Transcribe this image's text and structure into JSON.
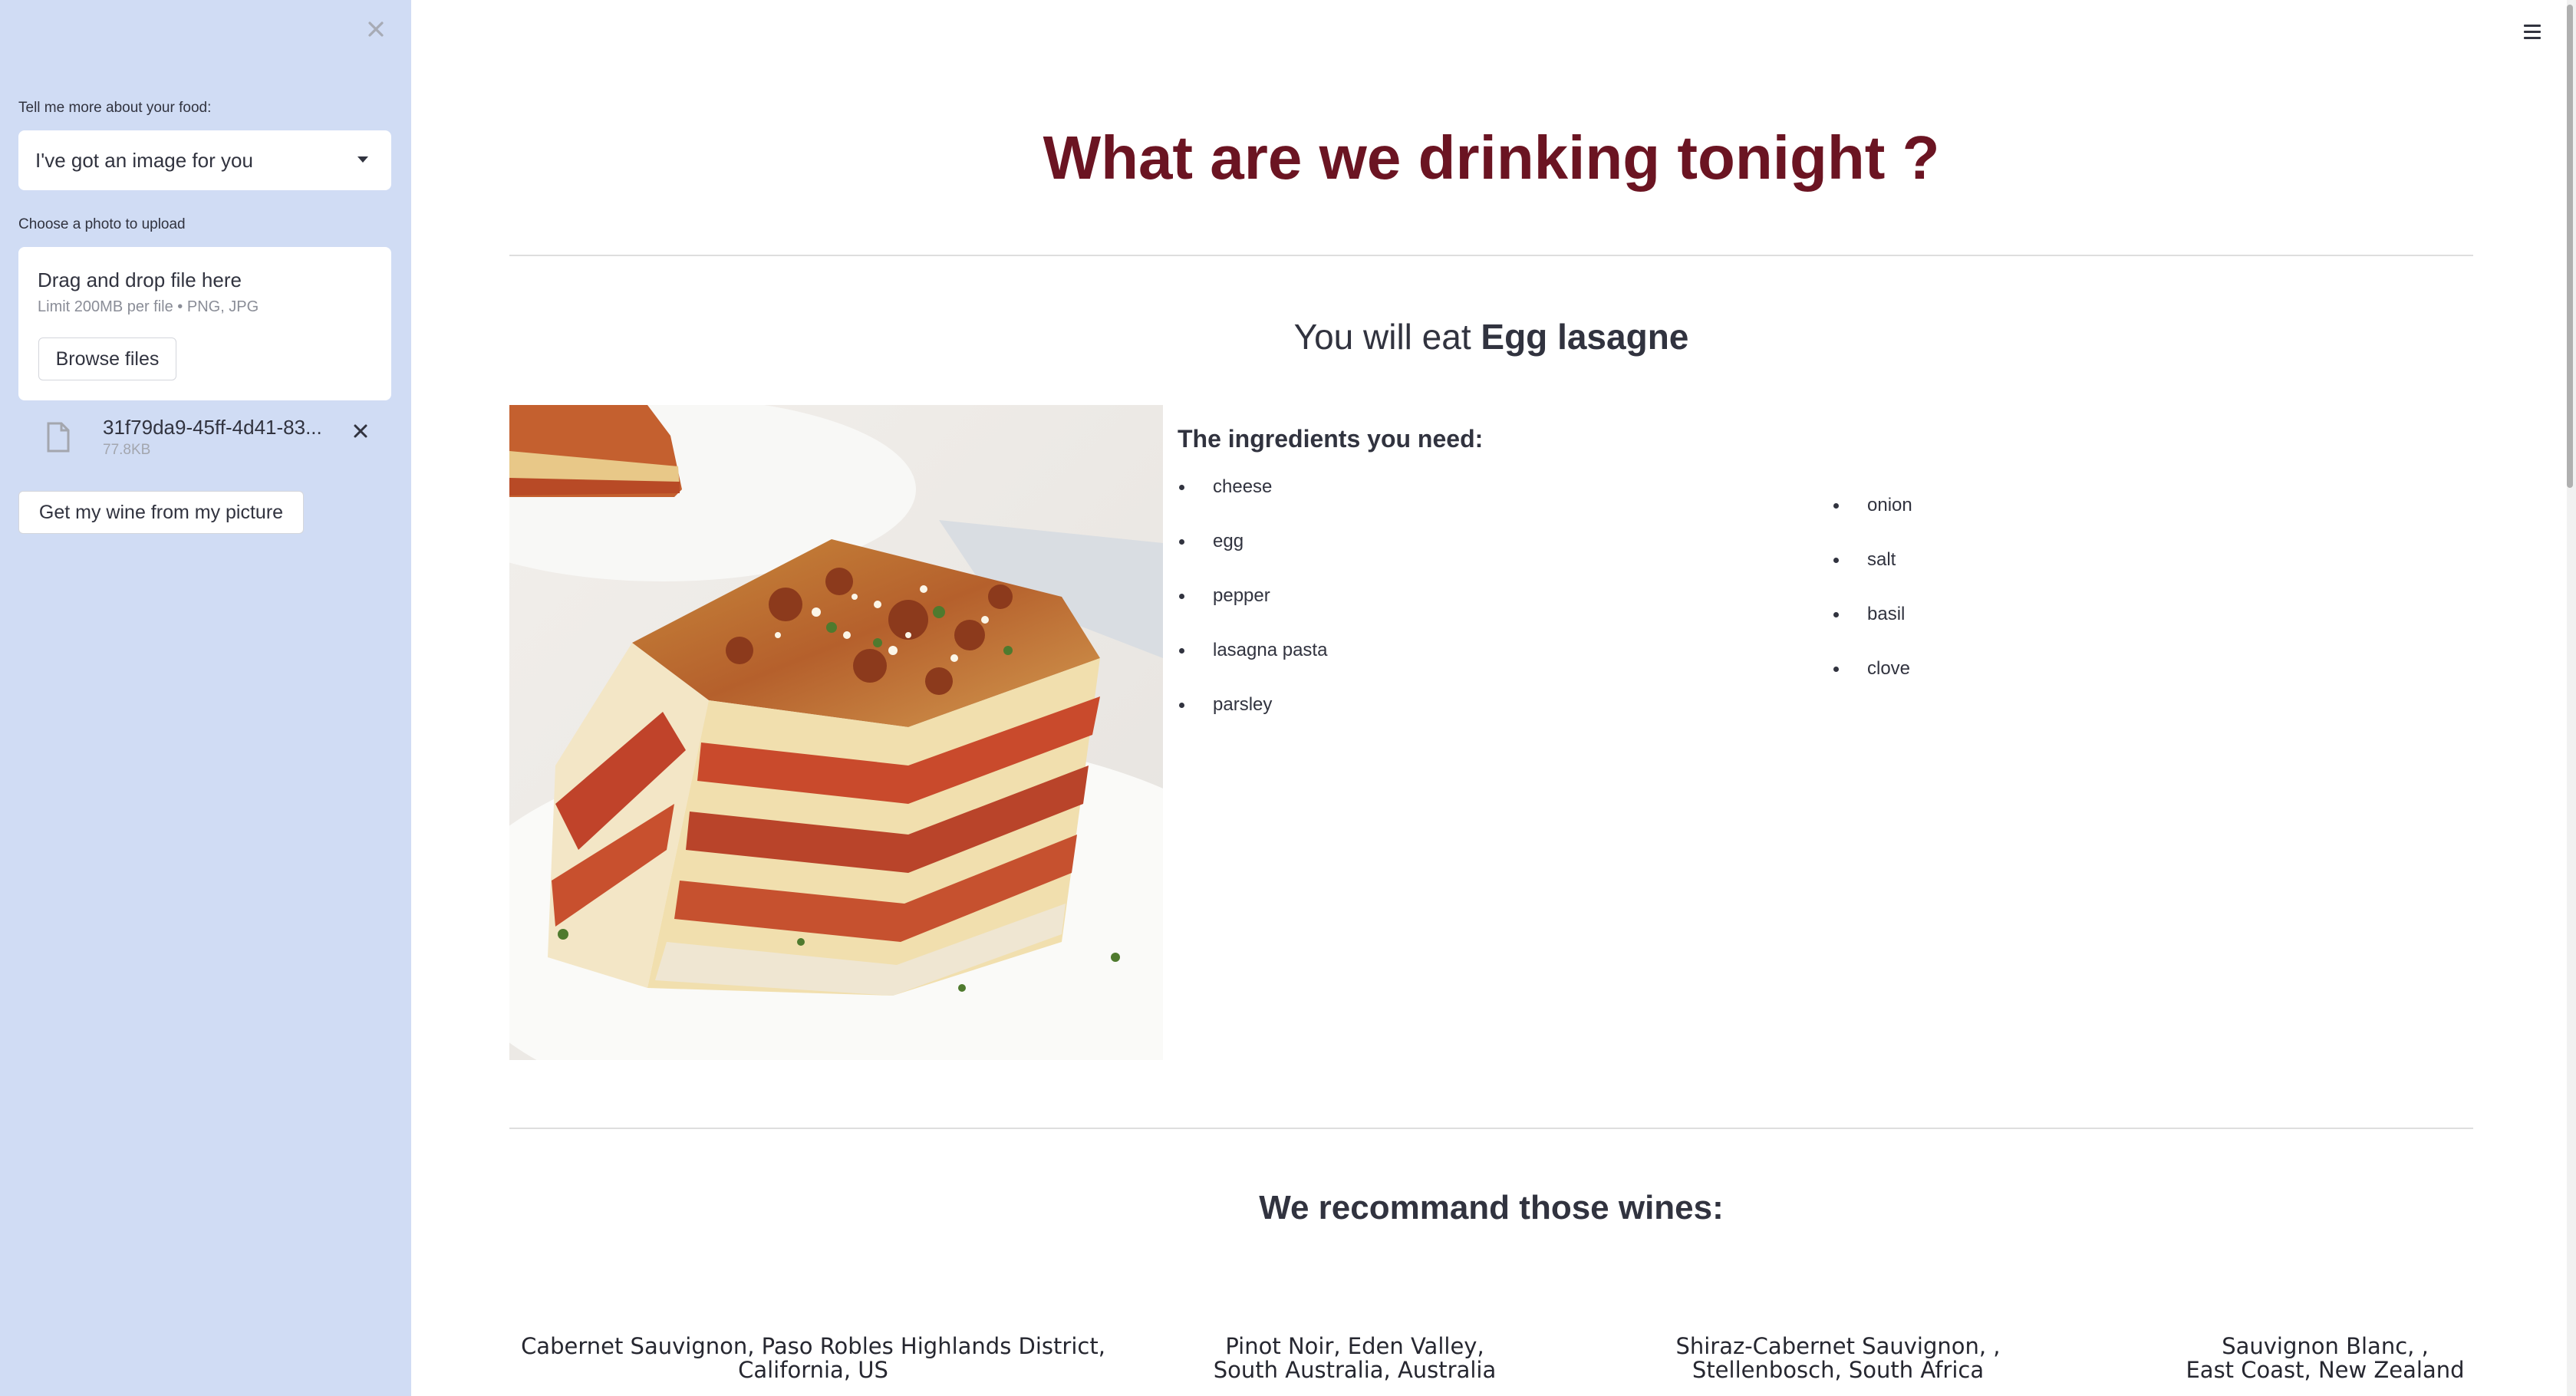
{
  "sidebar": {
    "close_icon": "close-icon",
    "food_label": "Tell me more about your food:",
    "food_select_value": "I've got an image for you",
    "upload_label": "Choose a photo to upload",
    "dropzone_title": "Drag and drop file here",
    "dropzone_limit": "Limit 200MB per file • PNG, JPG",
    "browse_button": "Browse files",
    "uploaded_file": {
      "name": "31f79da9-45ff-4d41-83...",
      "size": "77.8KB"
    },
    "wine_button": "Get my wine from my picture"
  },
  "main": {
    "menu_icon": "hamburger-menu-icon",
    "title": "What are we drinking tonight ?",
    "eat_prefix": "You will eat ",
    "dish": "Egg lasagne",
    "ingredients_title": "The ingredients you need:",
    "ingredients_left": [
      "cheese",
      "egg",
      "pepper",
      "lasagna pasta",
      "parsley"
    ],
    "ingredients_right": [
      "onion",
      "salt",
      "basil",
      "clove"
    ],
    "wines_title": "We recommand those wines:",
    "wines": [
      {
        "line1": "Cabernet Sauvignon, Paso Robles Highlands District,",
        "line2": "California, US"
      },
      {
        "line1": "Pinot Noir, Eden Valley,",
        "line2": "South Australia, Australia"
      },
      {
        "line1": "Shiraz-Cabernet Sauvignon, ,",
        "line2": "Stellenbosch, South Africa"
      },
      {
        "line1": "Sauvignon Blanc, ,",
        "line2": "East Coast, New Zealand"
      }
    ]
  },
  "colors": {
    "sidebar_bg": "#d0dcf4",
    "title_color": "#6b1422",
    "text": "#31333f"
  }
}
